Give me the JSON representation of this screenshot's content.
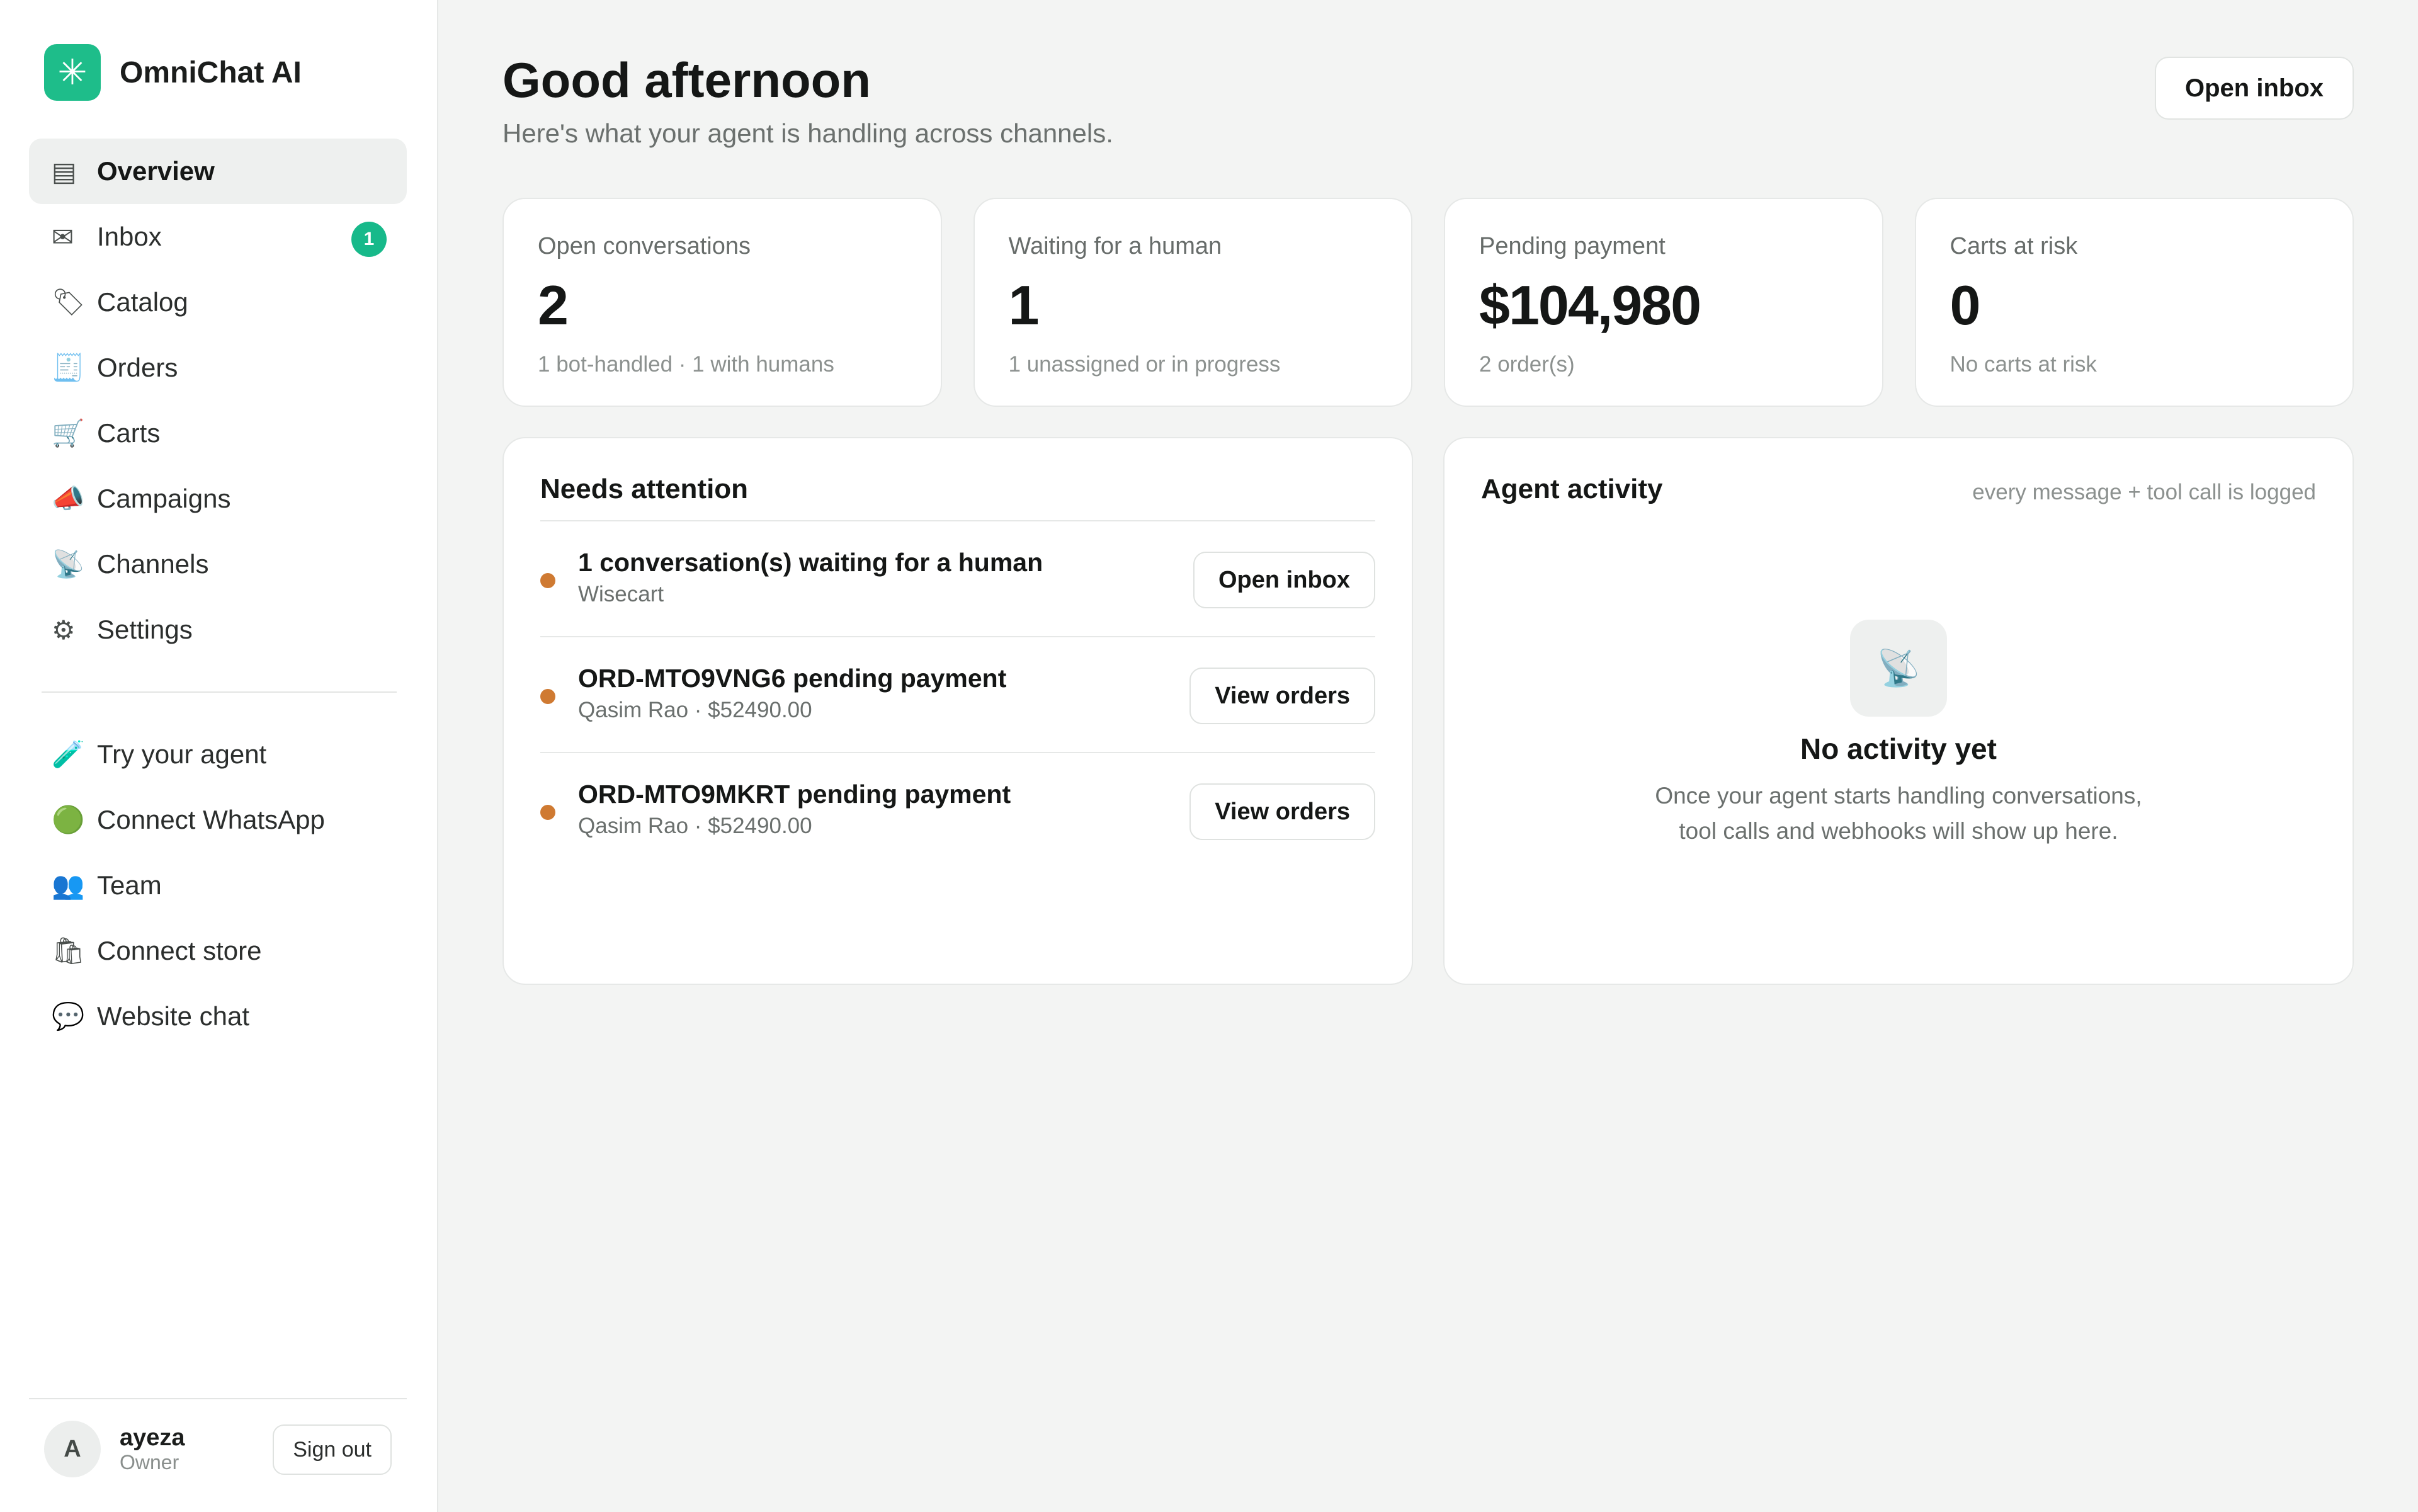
{
  "brand": {
    "name": "OmniChat AI",
    "logo_icon": "✳"
  },
  "nav_primary": [
    {
      "icon": "▤",
      "label": "Overview",
      "active": true
    },
    {
      "icon": "✉",
      "label": "Inbox",
      "badge": "1"
    },
    {
      "icon": "🏷",
      "label": "Catalog"
    },
    {
      "icon": "🧾",
      "label": "Orders"
    },
    {
      "icon": "🛒",
      "label": "Carts"
    },
    {
      "icon": "📣",
      "label": "Campaigns"
    },
    {
      "icon": "📡",
      "label": "Channels"
    },
    {
      "icon": "⚙",
      "label": "Settings"
    }
  ],
  "nav_secondary": [
    {
      "icon": "🧪",
      "label": "Try your agent"
    },
    {
      "icon": "🟢",
      "label": "Connect WhatsApp"
    },
    {
      "icon": "👥",
      "label": "Team"
    },
    {
      "icon": "🛍",
      "label": "Connect store"
    },
    {
      "icon": "💬",
      "label": "Website chat"
    }
  ],
  "user": {
    "initial": "A",
    "name": "ayeza",
    "role": "Owner",
    "signout_label": "Sign out"
  },
  "header": {
    "title": "Good afternoon",
    "subtitle": "Here's what your agent is handling across channels.",
    "open_inbox_label": "Open inbox"
  },
  "stats": [
    {
      "label": "Open conversations",
      "value": "2",
      "sub": "1 bot-handled · 1 with humans"
    },
    {
      "label": "Waiting for a human",
      "value": "1",
      "sub": "1 unassigned or in progress"
    },
    {
      "label": "Pending payment",
      "value": "$104,980",
      "sub": "2 order(s)"
    },
    {
      "label": "Carts at risk",
      "value": "0",
      "sub": "No carts at risk"
    }
  ],
  "attention": {
    "title": "Needs attention",
    "items": [
      {
        "title": "1 conversation(s) waiting for a human",
        "sub": "Wisecart",
        "action": "Open inbox"
      },
      {
        "title": "ORD-MTO9VNG6 pending payment",
        "sub": "Qasim Rao · $52490.00",
        "action": "View orders"
      },
      {
        "title": "ORD-MTO9MKRT pending payment",
        "sub": "Qasim Rao · $52490.00",
        "action": "View orders"
      }
    ]
  },
  "activity": {
    "title": "Agent activity",
    "note": "every message + tool call is logged",
    "empty_icon": "📡",
    "empty_title": "No activity yet",
    "empty_text": "Once your agent starts handling conversations, tool calls and webhooks will show up here."
  },
  "colors": {
    "brand": "#1ebd8a",
    "badge": "#17b98a",
    "status_dot": "#cf7a32",
    "background": "#f3f4f3"
  }
}
